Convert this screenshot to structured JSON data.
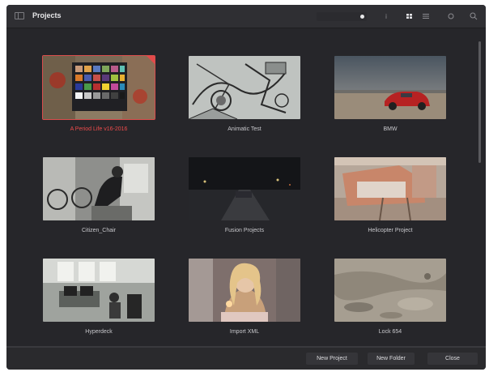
{
  "window": {
    "title": "Projects",
    "sort_label": ""
  },
  "projects": [
    {
      "name": "A Period Life v16-2016",
      "selected": true,
      "thumb": "colorchart"
    },
    {
      "name": "Animatic Test",
      "selected": false,
      "thumb": "sketch"
    },
    {
      "name": "BMW",
      "selected": false,
      "thumb": "car"
    },
    {
      "name": "Citizen_Chair",
      "selected": false,
      "thumb": "office"
    },
    {
      "name": "Fusion Projects",
      "selected": false,
      "thumb": "night"
    },
    {
      "name": "Helicopter Project",
      "selected": false,
      "thumb": "helicopter"
    },
    {
      "name": "Hyperdeck",
      "selected": false,
      "thumb": "room"
    },
    {
      "name": "Import XML",
      "selected": false,
      "thumb": "woman"
    },
    {
      "name": "Lock 654",
      "selected": false,
      "thumb": "rock"
    }
  ],
  "footer": {
    "new_project": "New Project",
    "new_folder": "New Folder",
    "close": "Close"
  },
  "colors": {
    "accent_selected": "#ee4b4b",
    "window_bg": "#2a2a2d"
  },
  "icons": [
    "sidebar-toggle-icon",
    "sort-dropdown-icon",
    "info-icon",
    "grid-view-icon",
    "list-view-icon",
    "settings-icon",
    "search-icon"
  ]
}
